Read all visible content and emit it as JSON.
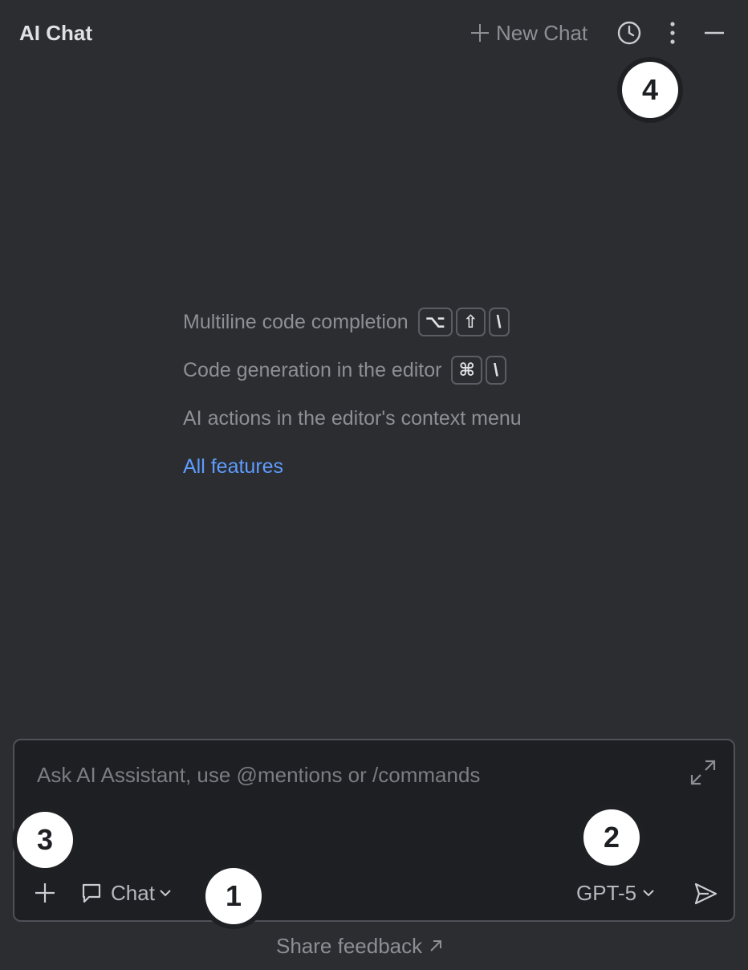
{
  "header": {
    "title": "AI Chat",
    "new_chat_label": "New Chat",
    "icons": [
      "plus-icon",
      "history-icon",
      "more-vertical-icon",
      "minimize-icon"
    ]
  },
  "tips": [
    {
      "label": "Multiline code completion",
      "keys": [
        "⌥",
        "⇧",
        "\\"
      ]
    },
    {
      "label": "Code generation in the editor",
      "keys": [
        "⌘",
        "\\"
      ]
    },
    {
      "label": "AI actions in the editor's context menu",
      "keys": []
    }
  ],
  "all_features_label": "All features",
  "composer": {
    "placeholder": "Ask AI Assistant, use @mentions or /commands",
    "value": "",
    "mode_label": "Chat",
    "model_label": "GPT-5"
  },
  "feedback_label": "Share feedback",
  "callouts": [
    "1",
    "2",
    "3",
    "4"
  ],
  "colors": {
    "background": "#2b2d30",
    "input_background": "#1e1f22",
    "link": "#5e9cff",
    "muted_text": "#8c8f94",
    "badge": "#ffffff"
  }
}
